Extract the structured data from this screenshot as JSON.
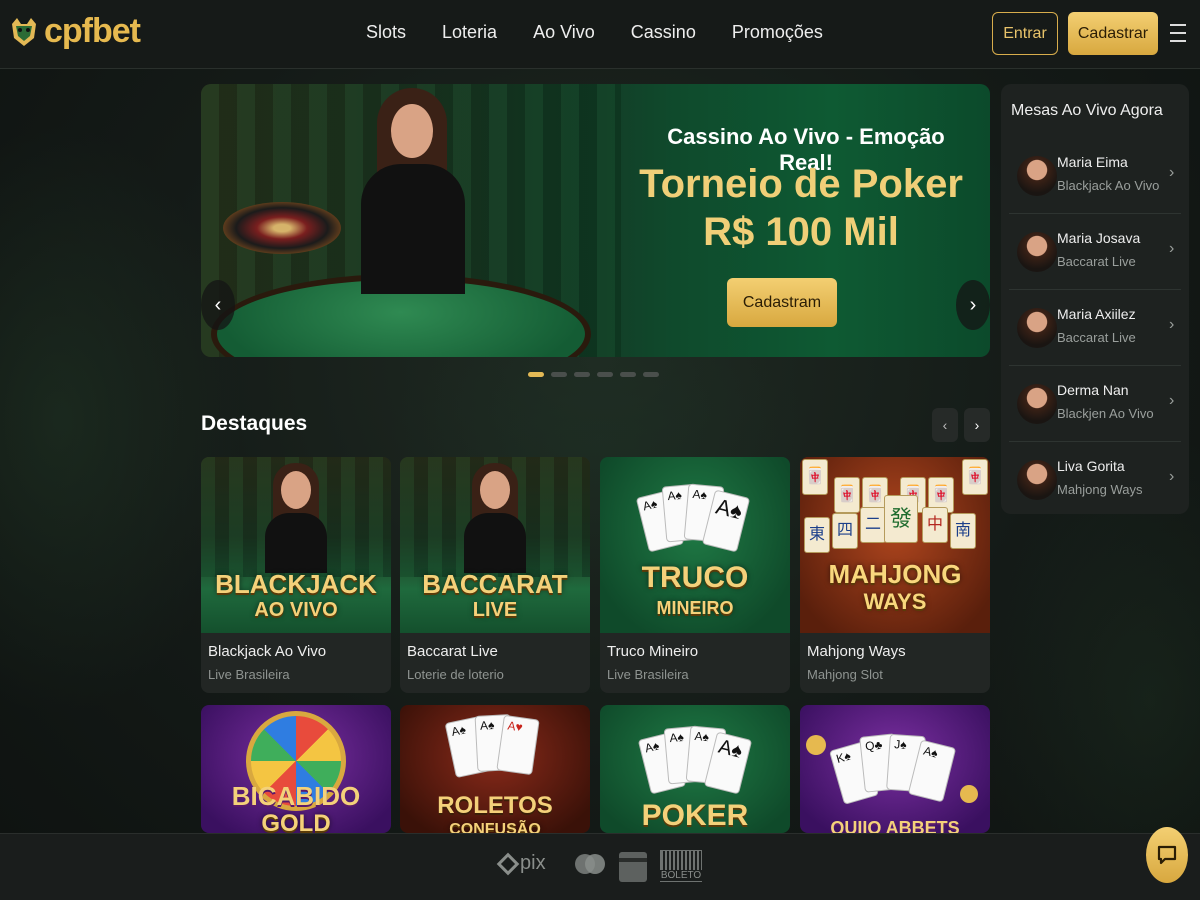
{
  "header": {
    "logo_text": "cpfbet",
    "nav": [
      "Slots",
      "Loteria",
      "Ao Vivo",
      "Cassino",
      "Promoções"
    ],
    "login_label": "Entrar",
    "signup_label": "Cadastrar"
  },
  "hero": {
    "title": "Cassino Ao Vivo - Emoção Real!",
    "promo_line1": "Torneio de Poker",
    "promo_line2": "R$ 100 Mil",
    "button_label": "Cadastram",
    "slide_count": 6,
    "active_slide": 1
  },
  "live_tables": {
    "title": "Mesas Ao Vivo Agora",
    "items": [
      {
        "name": "Maria Eima",
        "game": "Blackjack Ao Vivo"
      },
      {
        "name": "Maria Josava",
        "game": "Baccarat Live"
      },
      {
        "name": "Maria Axiilez",
        "game": "Baccarat Live"
      },
      {
        "name": "Derma Nan",
        "game": "Blackjen Ao Vivo"
      },
      {
        "name": "Liva Gorita",
        "game": "Mahjong Ways"
      }
    ]
  },
  "featured": {
    "title": "Destaques",
    "cards": [
      {
        "art_title_1": "BLACKJACK",
        "art_title_2": "AO VIVO",
        "name": "Blackjack Ao Vivo",
        "sub": "Live Brasileira"
      },
      {
        "art_title_1": "BACCARAT",
        "art_title_2": "LIVE",
        "name": "Baccarat Live",
        "sub": "Loterie de loterio"
      },
      {
        "art_title_1": "TRUCO",
        "art_title_2": "MINEIRO",
        "name": "Truco Mineiro",
        "sub": "Live Brasileira"
      },
      {
        "art_title_1": "MAHJONG",
        "art_title_2": "WAYS",
        "name": "Mahjong Ways",
        "sub": "Mahjong Slot"
      }
    ],
    "row2": [
      {
        "art_title_1": "BICABIDO",
        "art_title_2": "GOLD"
      },
      {
        "art_title_1": "ROLETOS",
        "art_title_2": "CONFUSÃO"
      },
      {
        "art_title_1": "POKER",
        "art_title_2": ""
      },
      {
        "art_title_1": "QUIIO ABBETS",
        "art_title_2": ""
      }
    ]
  },
  "footer": {
    "payments": [
      "pix",
      "mastercard",
      "card",
      "BOLETO"
    ]
  },
  "colors": {
    "accent": "#e3b955",
    "bg": "#141a17"
  }
}
